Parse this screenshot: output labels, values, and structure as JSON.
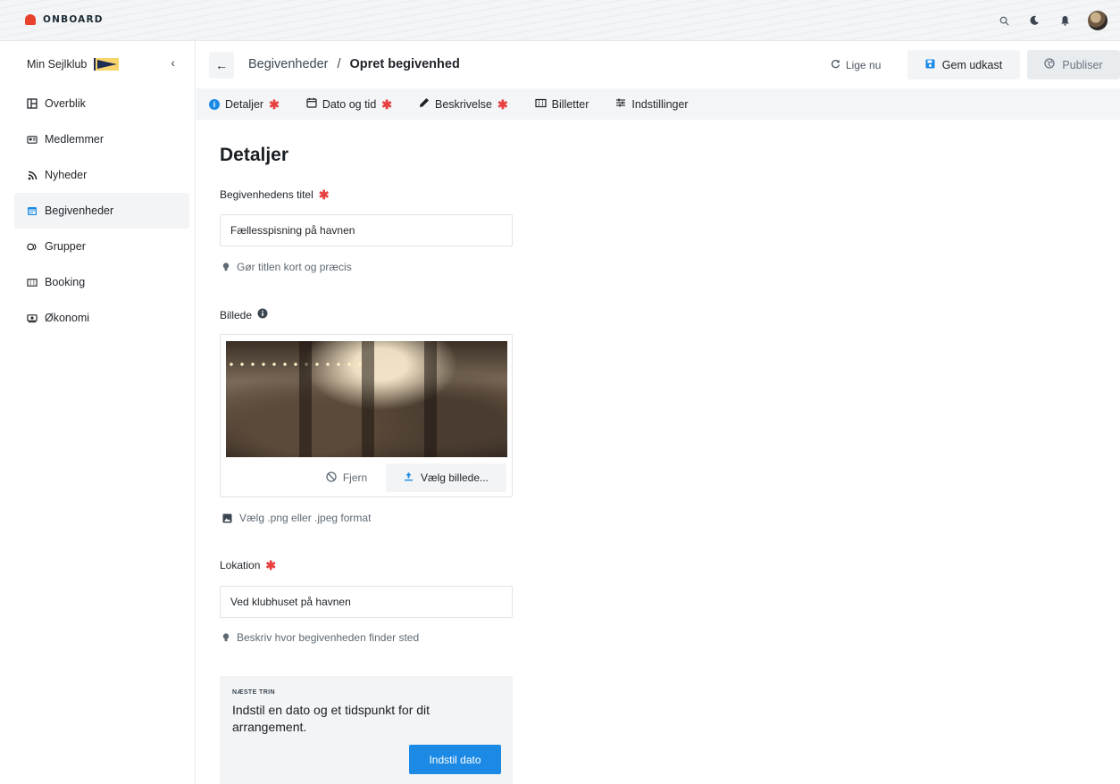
{
  "app": {
    "brand": "ONBOARD"
  },
  "topbar": {
    "icons": [
      "search-icon",
      "moon-icon",
      "bell-icon",
      "avatar"
    ]
  },
  "sidebar": {
    "club_name": "Min Sejlklub",
    "collapse_label": "‹",
    "items": [
      {
        "label": "Overblik",
        "icon": "layout-icon",
        "active": false
      },
      {
        "label": "Medlemmer",
        "icon": "id-card-icon",
        "active": false
      },
      {
        "label": "Nyheder",
        "icon": "rss-icon",
        "active": false
      },
      {
        "label": "Begivenheder",
        "icon": "calendar-icon",
        "active": true
      },
      {
        "label": "Grupper",
        "icon": "groups-icon",
        "active": false
      },
      {
        "label": "Booking",
        "icon": "ticket-icon",
        "active": false
      },
      {
        "label": "Økonomi",
        "icon": "money-icon",
        "active": false
      }
    ]
  },
  "header": {
    "back_label": "←",
    "breadcrumb_parent": "Begivenheder",
    "breadcrumb_separator": "/",
    "breadcrumb_current": "Opret begivenhed",
    "saved_status": "Lige nu",
    "save_draft_label": "Gem udkast",
    "publish_label": "Publiser"
  },
  "tabs": [
    {
      "label": "Detaljer",
      "required": "✱",
      "icon": "info-icon"
    },
    {
      "label": "Dato og tid",
      "required": "✱",
      "icon": "calendar-icon"
    },
    {
      "label": "Beskrivelse",
      "required": "✱",
      "icon": "pencil-icon"
    },
    {
      "label": "Billetter",
      "required": "",
      "icon": "ticket-icon"
    },
    {
      "label": "Indstillinger",
      "required": "",
      "icon": "sliders-icon"
    }
  ],
  "form": {
    "heading": "Detaljer",
    "title_label": "Begivenhedens titel",
    "title_required": "✱",
    "title_value": "Fællesspisning på havnen",
    "title_hint": "Gør titlen kort og præcis",
    "image_label": "Billede",
    "remove_label": "Fjern",
    "choose_label": "Vælg billede...",
    "image_hint": "Vælg .png eller .jpeg format",
    "location_label": "Lokation",
    "location_required": "✱",
    "location_value": "Ved klubhuset på havnen",
    "location_hint": "Beskriv hvor begivenheden finder sted"
  },
  "next_step": {
    "eyebrow": "NÆSTE TRIN",
    "title": "Indstil en dato og et tidspunkt for dit arrangement.",
    "button_label": "Indstil dato"
  },
  "colors": {
    "accent": "#1c8ae5",
    "required": "#e84040",
    "brand": "#e8412c"
  }
}
